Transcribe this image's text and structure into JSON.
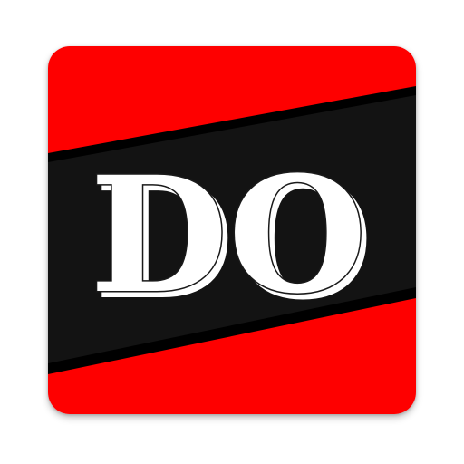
{
  "icon": {
    "monogram": "DO",
    "colors": {
      "background_red": "#fe0000",
      "band_black": "#131313",
      "band_edge": "#000000",
      "letter_fill": "#ffffff",
      "letter_outline": "#1a1a1a"
    }
  }
}
